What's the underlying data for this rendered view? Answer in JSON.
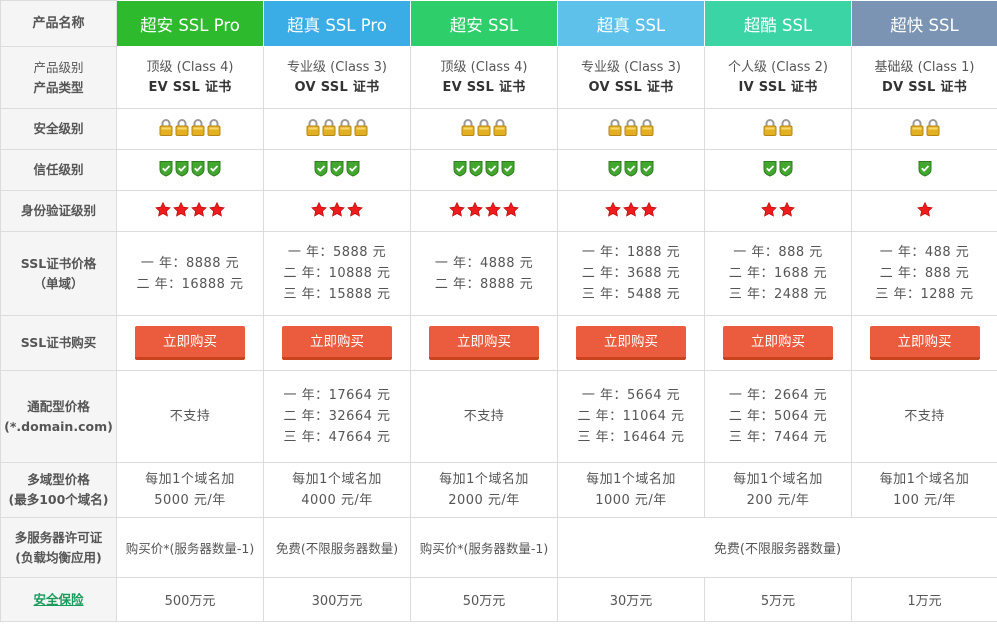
{
  "colors": {
    "header": [
      "#2dbb2d",
      "#3aade6",
      "#2ecf6a",
      "#5ec1ea",
      "#3bd4a4",
      "#7b94b3"
    ],
    "button": "#ea5c3d",
    "insurance_link": "#1a9b5c"
  },
  "labels": {
    "name": "产品名称",
    "level": "产品级别",
    "type": "产品类型",
    "security": "安全级别",
    "trust": "信任级别",
    "verify": "身份验证级别",
    "price_a": "SSL证书价格",
    "price_b": "（单域）",
    "buy": "SSL证书购买",
    "wild_a": "通配型价格",
    "wild_b": "(*.domain.com)",
    "multi_a": "多域型价格",
    "multi_b": "(最多100个域名)",
    "server_a": "多服务器许可证",
    "server_b": "(负载均衡应用)",
    "insurance": "安全保险"
  },
  "products": [
    {
      "name": "超安 SSL Pro",
      "level": "顶级 (Class 4)",
      "type": "EV SSL 证书",
      "locks": 4,
      "shields": 4,
      "stars": 4,
      "price": [
        "一 年：8888 元",
        "二 年：16888 元"
      ],
      "buy": "立即购买",
      "wild": [
        "不支持"
      ],
      "multi": [
        "每加1个域名加",
        "5000 元/年"
      ],
      "server": "购买价*(服务器数量-1)",
      "insurance": "500万元"
    },
    {
      "name": "超真 SSL Pro",
      "level": "专业级 (Class 3)",
      "type": "OV SSL 证书",
      "locks": 4,
      "shields": 3,
      "stars": 3,
      "price": [
        "一 年：5888 元",
        "二 年：10888 元",
        "三 年：15888 元"
      ],
      "buy": "立即购买",
      "wild": [
        "一 年：17664 元",
        "二 年：32664 元",
        "三 年：47664 元"
      ],
      "multi": [
        "每加1个域名加",
        "4000 元/年"
      ],
      "server": "免费(不限服务器数量)",
      "insurance": "300万元"
    },
    {
      "name": "超安 SSL",
      "level": "顶级 (Class 4)",
      "type": "EV SSL 证书",
      "locks": 3,
      "shields": 4,
      "stars": 4,
      "price": [
        "一 年：4888 元",
        "二 年：8888 元"
      ],
      "buy": "立即购买",
      "wild": [
        "不支持"
      ],
      "multi": [
        "每加1个域名加",
        "2000 元/年"
      ],
      "server": "购买价*(服务器数量-1)",
      "insurance": "50万元"
    },
    {
      "name": "超真 SSL",
      "level": "专业级 (Class 3)",
      "type": "OV SSL 证书",
      "locks": 3,
      "shields": 3,
      "stars": 3,
      "price": [
        "一 年：1888 元",
        "二 年：3688 元",
        "三 年：5488 元"
      ],
      "buy": "立即购买",
      "wild": [
        "一 年：5664 元",
        "二 年：11064 元",
        "三 年：16464 元"
      ],
      "multi": [
        "每加1个域名加",
        "1000 元/年"
      ],
      "insurance": "30万元"
    },
    {
      "name": "超酷 SSL",
      "level": "个人级 (Class 2)",
      "type": "IV SSL 证书",
      "locks": 2,
      "shields": 2,
      "stars": 2,
      "price": [
        "一 年：888 元",
        "二 年：1688 元",
        "三 年：2488 元"
      ],
      "buy": "立即购买",
      "wild": [
        "一 年：2664 元",
        "二 年：5064 元",
        "三 年：7464 元"
      ],
      "multi": [
        "每加1个域名加",
        "200 元/年"
      ],
      "insurance": "5万元"
    },
    {
      "name": "超快 SSL",
      "level": "基础级 (Class 1)",
      "type": "DV SSL 证书",
      "locks": 2,
      "shields": 1,
      "stars": 1,
      "price": [
        "一 年：488 元",
        "二 年：888 元",
        "三 年：1288 元"
      ],
      "buy": "立即购买",
      "wild": [
        "不支持"
      ],
      "multi": [
        "每加1个域名加",
        "100 元/年"
      ],
      "insurance": "1万元"
    }
  ],
  "server_merged": "免费(不限服务器数量)",
  "icons": {
    "security": "lock-icon",
    "trust": "shield-check-icon",
    "verify": "star-icon"
  }
}
